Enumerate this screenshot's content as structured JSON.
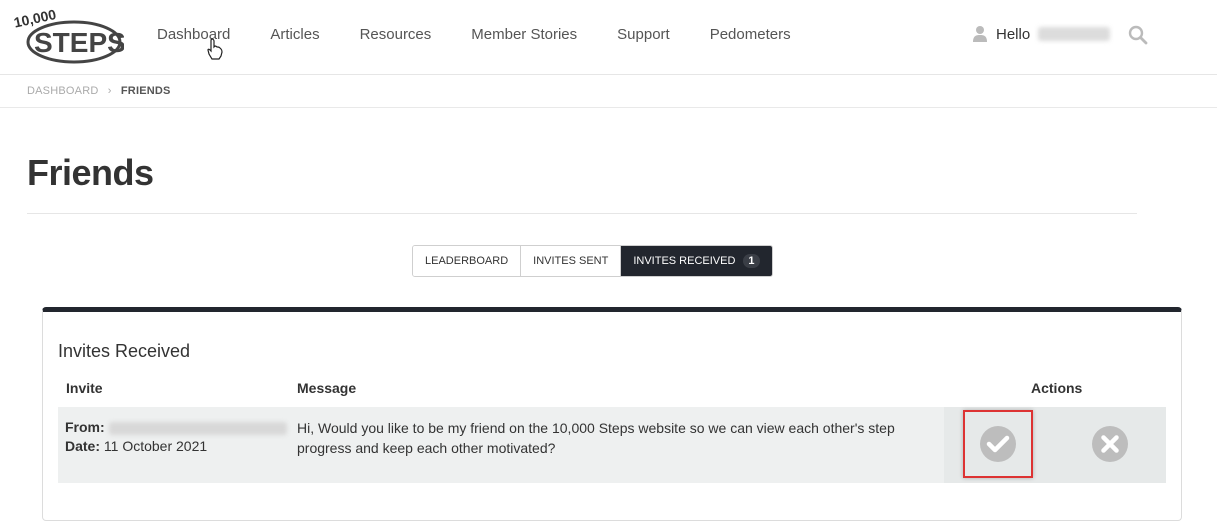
{
  "brand": {
    "logo_top": "10,000",
    "logo_main": "STEPS"
  },
  "nav": {
    "items": [
      "Dashboard",
      "Articles",
      "Resources",
      "Member Stories",
      "Support",
      "Pedometers"
    ]
  },
  "user": {
    "greeting": "Hello"
  },
  "breadcrumb": {
    "dashboard": "DASHBOARD",
    "current": "FRIENDS"
  },
  "page": {
    "title": "Friends"
  },
  "tabs": [
    {
      "label": "LEADERBOARD"
    },
    {
      "label": "INVITES SENT"
    },
    {
      "label": "INVITES RECEIVED",
      "badge": "1"
    }
  ],
  "invites": {
    "title": "Invites Received",
    "headers": {
      "invite": "Invite",
      "message": "Message",
      "actions": "Actions"
    },
    "rows": [
      {
        "from_label": "From:",
        "date_label": "Date:",
        "date": "11 October 2021",
        "message": "Hi, Would you like to be my friend on the 10,000 Steps website so we can view each other's step progress and keep each other motivated?"
      }
    ]
  },
  "colors": {
    "dark": "#22262e",
    "highlight": "#dd3333",
    "icon_grey": "#bdbdbd"
  },
  "icons": {
    "accept": "check-circle-icon",
    "decline": "x-circle-icon",
    "search": "search-icon",
    "user": "user-icon"
  }
}
